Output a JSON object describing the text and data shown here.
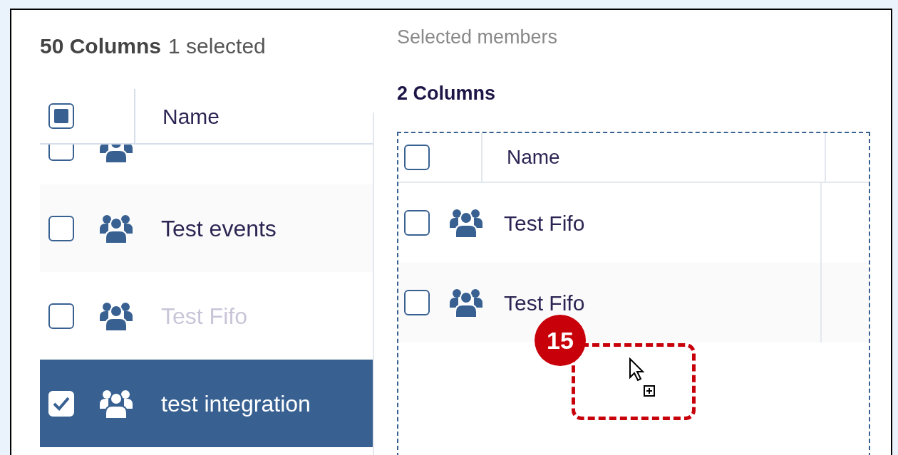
{
  "available": {
    "count": "50 Columns",
    "selection": "1 selected",
    "header_partial": true,
    "column": "Name",
    "rows": [
      {
        "checked": false,
        "selected": false,
        "clipped": true
      },
      {
        "name": "Test events",
        "checked": false,
        "selected": false,
        "dimmed": false,
        "clipped": false
      },
      {
        "name": "Test Fifo",
        "checked": false,
        "selected": false,
        "dimmed": true,
        "clipped": false
      },
      {
        "name": "test integration",
        "checked": true,
        "selected": true,
        "dimmed": false,
        "clipped": false
      }
    ]
  },
  "selected_members": {
    "title": "Selected members",
    "count": "2 Columns",
    "header_checked": false,
    "column": "Name",
    "rows": [
      {
        "name": "Test Fifo",
        "checked": false
      },
      {
        "name": "Test Fifo",
        "checked": false
      }
    ]
  },
  "annotation": {
    "step": "15"
  }
}
